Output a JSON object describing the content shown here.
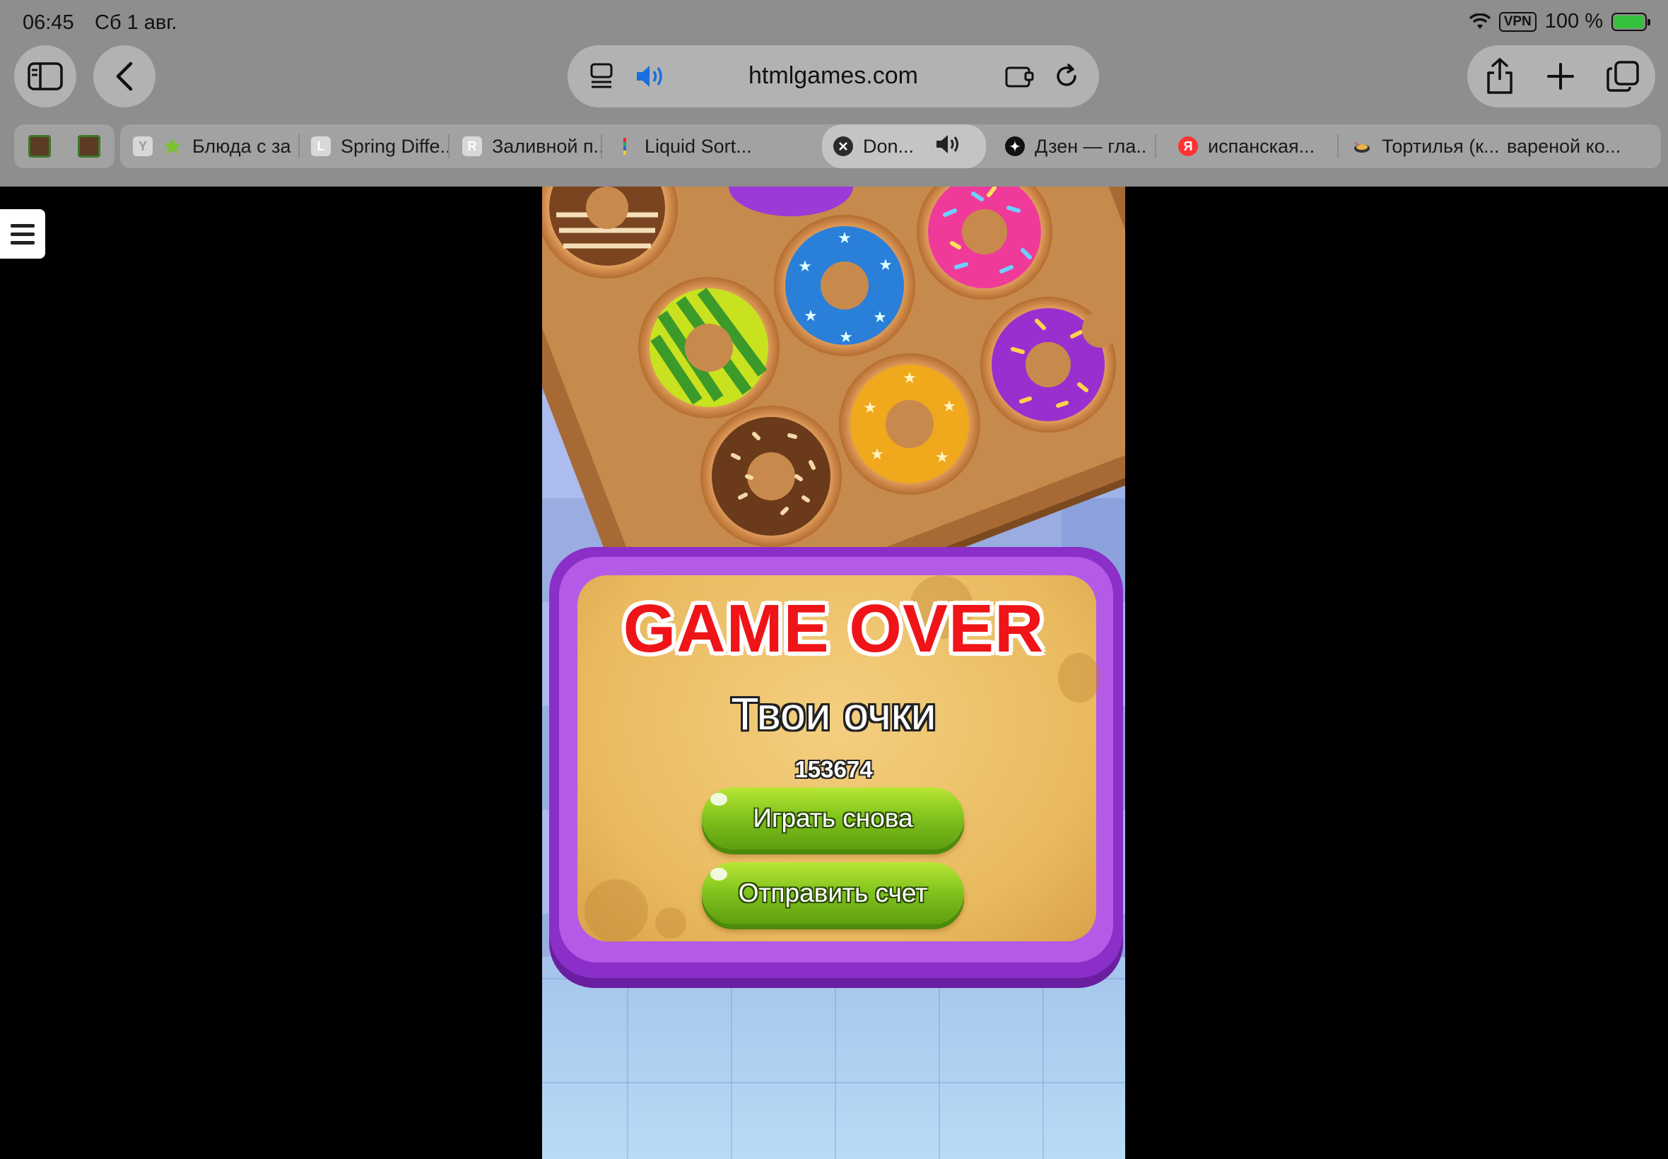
{
  "status": {
    "time": "06:45",
    "date": "Сб 1 авг.",
    "vpn": "VPN",
    "battery": "100 %"
  },
  "browser": {
    "url": "htmlgames.com",
    "tabs": [
      {
        "label": "Блюда с за",
        "icon": "star-favicon"
      },
      {
        "label": "Spring Diffe...",
        "icon": "L"
      },
      {
        "label": "Заливной п...",
        "icon": "R"
      },
      {
        "label": "Liquid Sort...",
        "icon": "bottles-favicon"
      },
      {
        "label": "Don...",
        "icon": "close-icon",
        "active": true
      },
      {
        "label": "Дзен — гла...",
        "icon": "zen-favicon"
      },
      {
        "label": "испанская...",
        "icon": "Я"
      },
      {
        "label": "Тортилья (к...",
        "icon": "pan-favicon"
      },
      {
        "label": "вареной ко...",
        "icon": ""
      }
    ],
    "tab_letter_y": "Y"
  },
  "game": {
    "title": "GAME OVER",
    "score_label": "Твои очки",
    "score": "153674",
    "play_again": "Играть снова",
    "submit_score": "Отправить счет"
  },
  "colors": {
    "chrome": "#8e8e8e",
    "title_red": "#ee1418",
    "button_green": "#7fc21c",
    "panel_purple": "#8a2fc8"
  }
}
